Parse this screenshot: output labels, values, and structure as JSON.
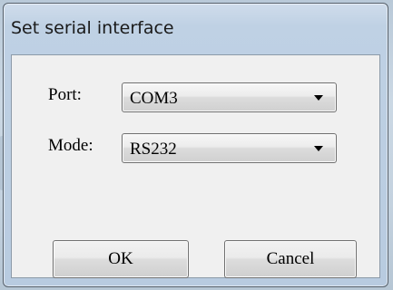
{
  "window": {
    "title": "Set serial interface"
  },
  "form": {
    "port": {
      "label": "Port:",
      "value": "COM3"
    },
    "mode": {
      "label": "Mode:",
      "value": "RS232"
    }
  },
  "buttons": {
    "ok_label": "OK",
    "cancel_label": "Cancel"
  },
  "icons": {
    "dropdown": "chevron-down-icon"
  }
}
